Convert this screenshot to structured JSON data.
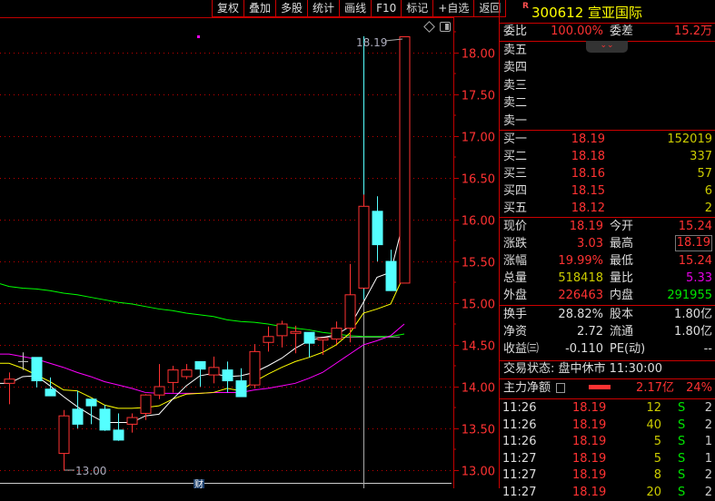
{
  "toolbar": [
    "复权",
    "叠加",
    "多股",
    "统计",
    "画线",
    "F10",
    "标记",
    "+自选",
    "返回"
  ],
  "stock": {
    "badge": "R",
    "code": "300612",
    "name": "宣亚国际"
  },
  "weibi": {
    "label": "委比",
    "value": "100.00%",
    "label2": "委差",
    "value2": "15.2万"
  },
  "collapse_icon": "chevron-double-down",
  "sell": [
    {
      "label": "卖五"
    },
    {
      "label": "卖四"
    },
    {
      "label": "卖三"
    },
    {
      "label": "卖二"
    },
    {
      "label": "卖一"
    }
  ],
  "buy": [
    {
      "label": "买一",
      "price": "18.19",
      "vol": "152019"
    },
    {
      "label": "买二",
      "price": "18.18",
      "vol": "337"
    },
    {
      "label": "买三",
      "price": "18.16",
      "vol": "57"
    },
    {
      "label": "买四",
      "price": "18.15",
      "vol": "6"
    },
    {
      "label": "买五",
      "price": "18.12",
      "vol": "2"
    }
  ],
  "stats": [
    {
      "l1": "现价",
      "v1": "18.19",
      "c1": "red",
      "l2": "今开",
      "v2": "15.24",
      "c2": "red"
    },
    {
      "l1": "涨跌",
      "v1": "3.03",
      "c1": "red",
      "l2": "最高",
      "v2": "18.19",
      "c2": "red"
    },
    {
      "l1": "涨幅",
      "v1": "19.99%",
      "c1": "red",
      "l2": "最低",
      "v2": "15.24",
      "c2": "red"
    },
    {
      "l1": "总量",
      "v1": "518418",
      "c1": "yel",
      "l2": "量比",
      "v2": "5.33",
      "c2": "mag"
    },
    {
      "l1": "外盘",
      "v1": "226463",
      "c1": "red",
      "l2": "内盘",
      "v2": "291955",
      "c2": "grn"
    }
  ],
  "fund": [
    {
      "l1": "换手",
      "v1": "28.82%",
      "l2": "股本",
      "v2": "1.80亿"
    },
    {
      "l1": "净资",
      "v1": "2.72",
      "l2": "流通",
      "v2": "1.80亿"
    },
    {
      "l1": "收益㈢",
      "v1": "-0.110",
      "l2": "PE(动)",
      "v2": "--"
    }
  ],
  "status": "交易状态: 盘中休市 11:30:00",
  "main_flow": {
    "label": "主力净额",
    "value": "2.17亿",
    "pct": "24%"
  },
  "ticks": [
    {
      "t": "11:26",
      "p": "18.19",
      "q": "12",
      "s": "S",
      "n": "2"
    },
    {
      "t": "11:26",
      "p": "18.19",
      "q": "40",
      "s": "S",
      "n": "2"
    },
    {
      "t": "11:26",
      "p": "18.19",
      "q": "5",
      "s": "S",
      "n": "1"
    },
    {
      "t": "11:27",
      "p": "18.19",
      "q": "5",
      "s": "S",
      "n": "1"
    },
    {
      "t": "11:27",
      "p": "18.19",
      "q": "8",
      "s": "S",
      "n": "2"
    },
    {
      "t": "11:27",
      "p": "18.19",
      "q": "20",
      "s": "S",
      "n": "2"
    }
  ],
  "colors": {
    "up": "#ff3232",
    "down": "#54ffff",
    "ma5": "#ffffff",
    "ma10": "#ffff00",
    "ma20": "#ff00ff",
    "ma60": "#00ff00",
    "grid": "#c00000"
  },
  "chart_data": {
    "type": "candlestick",
    "yticks": [
      "18.00",
      "17.50",
      "17.00",
      "16.50",
      "16.00",
      "15.50",
      "15.00",
      "14.50",
      "14.00",
      "13.50",
      "13.00"
    ],
    "ylim": [
      12.95,
      18.45
    ],
    "max_label": "18.19",
    "min_label": "13.00",
    "marker": "财",
    "candles": [
      [
        14.04,
        14.09,
        14.17,
        13.79
      ],
      [
        14.3,
        14.3,
        14.41,
        14.2
      ],
      [
        14.35,
        14.07,
        14.35,
        13.99
      ],
      [
        13.97,
        13.89,
        14.11,
        13.89
      ],
      [
        13.2,
        13.65,
        13.72,
        13.0
      ],
      [
        13.73,
        13.55,
        13.95,
        13.5
      ],
      [
        13.85,
        13.77,
        13.85,
        13.55
      ],
      [
        13.73,
        13.48,
        13.78,
        13.47
      ],
      [
        13.48,
        13.36,
        13.68,
        13.35
      ],
      [
        13.55,
        13.63,
        13.68,
        13.45
      ],
      [
        13.68,
        13.9,
        13.91,
        13.6
      ],
      [
        13.9,
        14.0,
        14.27,
        13.85
      ],
      [
        14.05,
        14.2,
        14.25,
        13.93
      ],
      [
        14.12,
        14.2,
        14.27,
        14.09
      ],
      [
        14.3,
        14.21,
        14.3,
        14.0
      ],
      [
        14.14,
        14.23,
        14.36,
        14.04
      ],
      [
        14.2,
        14.07,
        14.3,
        13.93
      ],
      [
        14.07,
        13.88,
        14.22,
        13.88
      ],
      [
        14.02,
        14.42,
        14.51,
        13.98
      ],
      [
        14.53,
        14.6,
        14.72,
        14.42
      ],
      [
        14.61,
        14.75,
        14.79,
        14.47
      ],
      [
        14.64,
        14.66,
        14.73,
        14.4
      ],
      [
        14.65,
        14.52,
        14.65,
        14.35
      ],
      [
        14.56,
        14.58,
        14.58,
        14.38
      ],
      [
        14.57,
        14.7,
        14.78,
        14.51
      ],
      [
        14.7,
        15.1,
        15.47,
        14.53
      ],
      [
        15.18,
        16.16,
        16.3,
        15.18
      ],
      [
        16.1,
        15.7,
        16.28,
        15.5
      ],
      [
        15.5,
        15.15,
        15.64,
        15.15
      ],
      [
        15.24,
        18.19,
        18.19,
        15.24
      ]
    ],
    "ma": {
      "ma5": [
        14.04,
        14.12,
        14.13,
        14.01,
        13.88,
        13.76,
        13.66,
        13.57,
        13.57,
        13.57,
        13.65,
        13.67,
        13.85,
        14.01,
        14.13,
        14.16,
        14.12,
        14.13,
        14.17,
        14.25,
        14.34,
        14.46,
        14.55,
        14.59,
        14.62,
        14.72,
        15.01,
        15.31,
        15.37,
        16.02
      ],
      "ma10": [
        14.28,
        14.22,
        14.14,
        14.06,
        13.96,
        13.95,
        13.87,
        13.78,
        13.74,
        13.74,
        13.75,
        13.77,
        13.85,
        13.91,
        13.92,
        13.93,
        13.98,
        13.95,
        14.06,
        14.15,
        14.23,
        14.3,
        14.35,
        14.41,
        14.5,
        14.64,
        14.88,
        14.93,
        14.99,
        15.34
      ],
      "ma20": [
        14.39,
        14.36,
        14.33,
        14.28,
        14.23,
        14.17,
        14.12,
        14.06,
        14.02,
        13.98,
        13.93,
        13.92,
        13.92,
        13.92,
        13.92,
        13.93,
        13.93,
        13.93,
        13.96,
        13.98,
        14.01,
        14.04,
        14.1,
        14.17,
        14.28,
        14.39,
        14.5,
        14.55,
        14.61,
        14.75
      ],
      "ma60": [
        15.2,
        15.18,
        15.17,
        15.15,
        15.12,
        15.1,
        15.07,
        15.04,
        15.01,
        14.99,
        14.96,
        14.93,
        14.91,
        14.88,
        14.86,
        14.84,
        14.8,
        14.78,
        14.77,
        14.75,
        14.72,
        14.7,
        14.68,
        14.65,
        14.63,
        14.61,
        14.6,
        14.6,
        14.6,
        14.63
      ]
    }
  }
}
